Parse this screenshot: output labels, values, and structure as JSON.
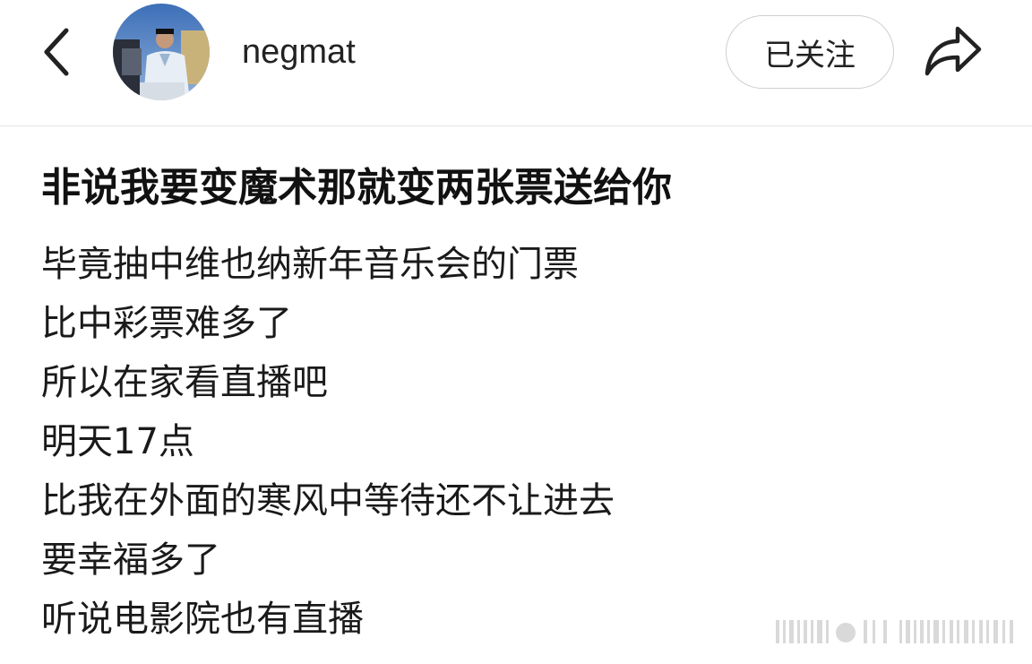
{
  "header": {
    "username": "negmat",
    "follow_label": "已关注",
    "back_icon": "chevron-left-icon",
    "share_icon": "share-arrow-icon"
  },
  "post": {
    "title": "非说我要变魔术那就变两张票送给你",
    "lines": [
      "毕竟抽中维也纳新年音乐会的门票",
      "比中彩票难多了",
      "所以在家看直播吧",
      "明天17点",
      "比我在外面的寒风中等待还不让进去",
      "要幸福多了",
      "听说电影院也有直播"
    ]
  },
  "colors": {
    "text": "#1a1a1a",
    "border": "#cfcfcf",
    "divider": "#e6e6e6"
  }
}
